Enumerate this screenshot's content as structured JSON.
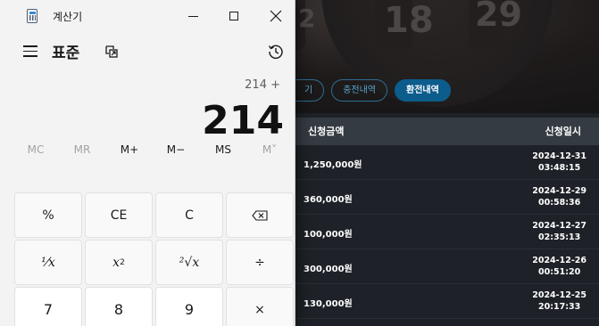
{
  "background_page": {
    "wheel_numbers": [
      "2",
      "18",
      "29"
    ],
    "buttons": [
      {
        "label": "기",
        "active": false
      },
      {
        "label": "충전내역",
        "active": false
      },
      {
        "label": "환전내역",
        "active": true
      }
    ],
    "table": {
      "headers": {
        "amount": "신청금액",
        "datetime": "신청일시"
      },
      "rows": [
        {
          "amount": "1,250,000원",
          "date": "2024-12-31",
          "time": "03:48:15"
        },
        {
          "amount": "360,000원",
          "date": "2024-12-29",
          "time": "00:58:36"
        },
        {
          "amount": "100,000원",
          "date": "2024-12-27",
          "time": "02:35:13"
        },
        {
          "amount": "300,000원",
          "date": "2024-12-26",
          "time": "00:51:20"
        },
        {
          "amount": "130,000원",
          "date": "2024-12-25",
          "time": "20:17:33"
        }
      ]
    }
  },
  "calculator": {
    "window_title": "계산기",
    "app_icon": "calculator-icon",
    "mode": "표준",
    "expression": "214 +",
    "display_value": "214",
    "memory_buttons": [
      {
        "label": "MC",
        "enabled": false
      },
      {
        "label": "MR",
        "enabled": false
      },
      {
        "label": "M+",
        "enabled": true
      },
      {
        "label": "M−",
        "enabled": true
      },
      {
        "label": "MS",
        "enabled": true
      },
      {
        "label": "M˅",
        "enabled": false
      }
    ],
    "keys": {
      "percent": "%",
      "clear_entry": "CE",
      "clear": "C",
      "backspace": "backspace-icon",
      "reciprocal": "⅟x",
      "square_base": "x",
      "square_exp": "2",
      "sqrt": "²√x",
      "divide": "÷",
      "seven": "7",
      "eight": "8",
      "nine": "9",
      "multiply": "×"
    },
    "colors": {
      "window_bg": "#f3f3f3",
      "key_bg": "#f9f9f9",
      "digit_key_bg": "#ffffff"
    }
  }
}
